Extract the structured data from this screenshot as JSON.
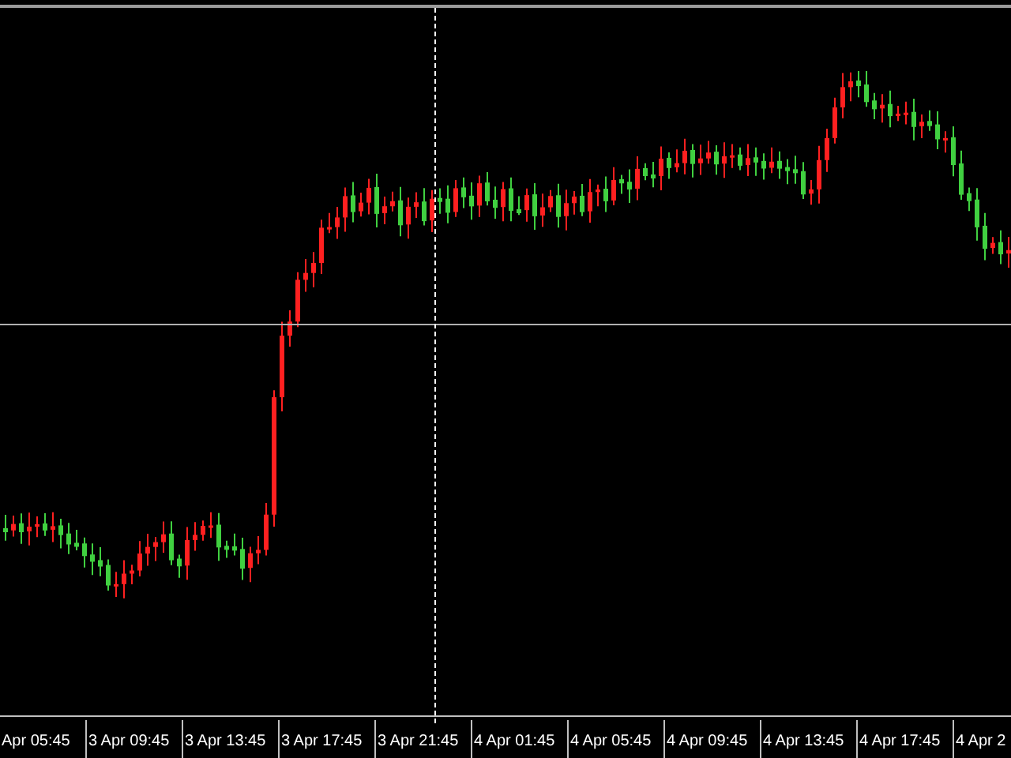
{
  "x_axis": {
    "labels": [
      "Apr 05:45",
      "3 Apr 09:45",
      "3 Apr 13:45",
      "3 Apr 17:45",
      "3 Apr 21:45",
      "4 Apr 01:45",
      "4 Apr 05:45",
      "4 Apr 09:45",
      "4 Apr 13:45",
      "4 Apr 17:45",
      "4 Apr 2"
    ]
  }
}
